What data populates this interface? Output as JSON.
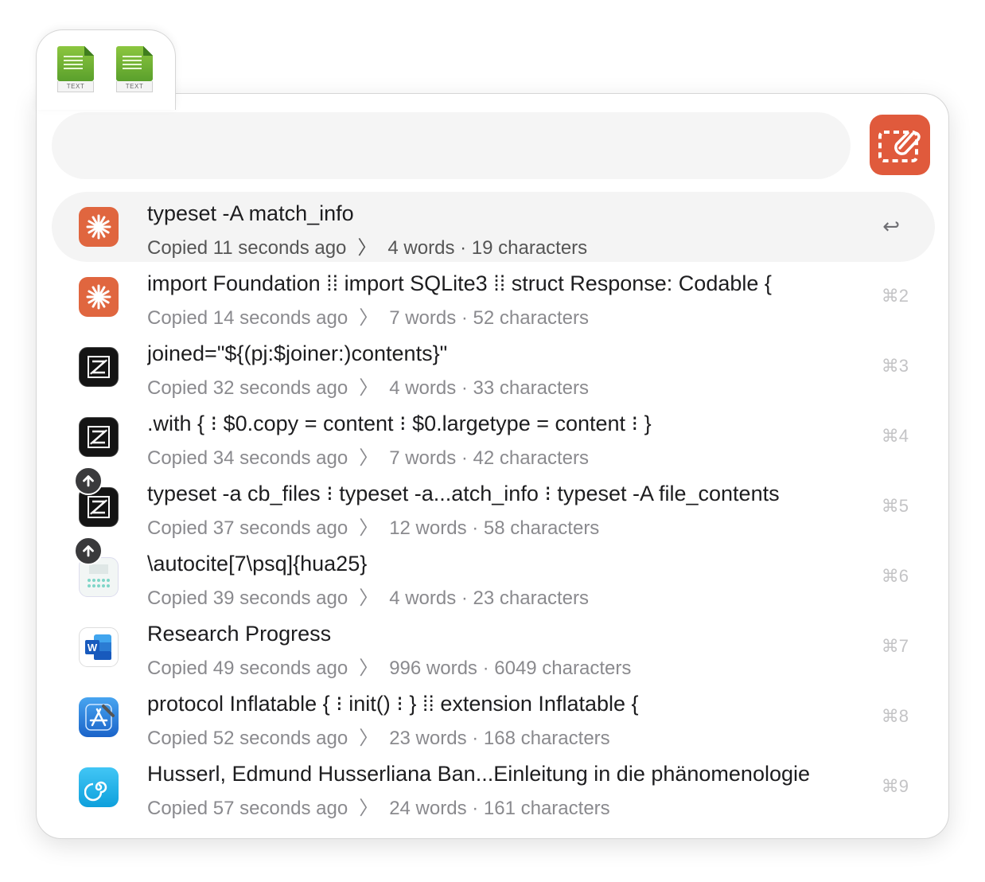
{
  "file_tab": {
    "files": [
      {
        "label": "TEXT",
        "icon": "text-document-icon"
      },
      {
        "label": "TEXT",
        "icon": "text-document-icon"
      }
    ]
  },
  "search": {
    "value": "",
    "placeholder": ""
  },
  "app_button": {
    "icon": "clipboard-paste-icon",
    "color": "#e05a3c"
  },
  "rows": [
    {
      "title": "typeset -A match_info",
      "copied": "Copied 11 seconds ago",
      "stats": "4 words · 19 characters",
      "shortcut": "↩",
      "app_icon": "claude-icon",
      "selected": true,
      "badge": false
    },
    {
      "title": "import Foundation ⁞⁞ import SQLite3 ⁞⁞ struct Response: Codable {",
      "copied": "Copied 14 seconds ago",
      "stats": "7 words · 52 characters",
      "shortcut": "⌘2",
      "app_icon": "claude-icon",
      "selected": false,
      "badge": false
    },
    {
      "title": "joined=\"${(pj:$joiner:)contents}\"",
      "copied": "Copied 32 seconds ago",
      "stats": "4 words · 33 characters",
      "shortcut": "⌘3",
      "app_icon": "zed-icon",
      "selected": false,
      "badge": false
    },
    {
      "title": ".with { ⁝ $0.copy = content ⁝ $0.largetype = content ⁝ }",
      "copied": "Copied 34 seconds ago",
      "stats": "7 words · 42 characters",
      "shortcut": "⌘4",
      "app_icon": "zed-icon",
      "selected": false,
      "badge": false
    },
    {
      "title": "typeset -a cb_files ⁝ typeset -a...atch_info ⁝ typeset -A file_contents",
      "copied": "Copied 37 seconds ago",
      "stats": "12 words · 58 characters",
      "shortcut": "⌘5",
      "app_icon": "zed-icon",
      "selected": false,
      "badge": true
    },
    {
      "title": "\\autocite[7\\psq]{hua25}",
      "copied": "Copied 39 seconds ago",
      "stats": "4 words · 23 characters",
      "shortcut": "⌘6",
      "app_icon": "keyboard-icon",
      "selected": false,
      "badge": true
    },
    {
      "title": "Research Progress",
      "copied": "Copied 49 seconds ago",
      "stats": "996 words · 6049 characters",
      "shortcut": "⌘7",
      "app_icon": "word-icon",
      "selected": false,
      "badge": false
    },
    {
      "title": "protocol Inflatable { ⁝ init() ⁝ } ⁞⁞ extension Inflatable {",
      "copied": "Copied 52 seconds ago",
      "stats": "23 words · 168 characters",
      "shortcut": "⌘8",
      "app_icon": "xcode-icon",
      "selected": false,
      "badge": false
    },
    {
      "title": "Husserl, Edmund Husserliana Ban...Einleitung in die phänomenologie",
      "copied": "Copied 57 seconds ago",
      "stats": "24 words · 161 characters",
      "shortcut": "⌘9",
      "app_icon": "nautilus-notes-icon",
      "selected": false,
      "badge": false
    }
  ],
  "chevron": "〉"
}
